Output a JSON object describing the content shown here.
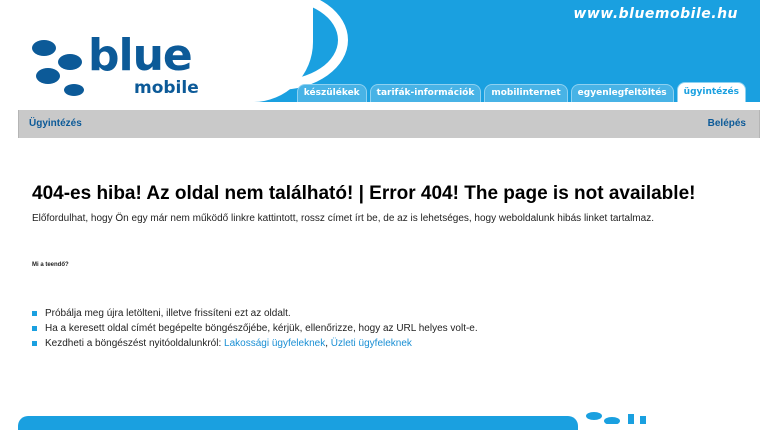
{
  "header": {
    "site_url": "www.bluemobile.hu",
    "logo_word": "blue",
    "logo_sub": "mobile"
  },
  "nav": {
    "tabs": [
      {
        "label": "készülékek",
        "active": false
      },
      {
        "label": "tarifák-információk",
        "active": false
      },
      {
        "label": "mobilinternet",
        "active": false
      },
      {
        "label": "egyenlegfeltöltés",
        "active": false
      },
      {
        "label": "ügyintézés",
        "active": true
      }
    ]
  },
  "subbar": {
    "breadcrumb": "Ügyintézés",
    "login": "Belépés"
  },
  "main": {
    "title": "404-es hiba! Az oldal nem található! | Error 404! The page is not available!",
    "description": "Előfordulhat, hogy Ön egy már nem működő linkre kattintott, rossz címet írt be, de az is lehetséges, hogy weboldalunk hibás linket tartalmaz.",
    "what_happened": "Mi a teendő?",
    "tips": {
      "reload": "Próbálja meg újra letölteni, illetve frissíteni ezt az oldalt.",
      "check_url": "Ha a keresett oldal címét begépelte böngészőjébe, kérjük, ellenőrizze, hogy az URL helyes volt-e.",
      "start_prefix": "Kezdheti a böngészést nyitóoldalunkról: ",
      "residential_link": "Lakossági ügyfeleknek",
      "separator": ", ",
      "business_link": "Üzleti ügyfeleknek"
    }
  },
  "colors": {
    "brand_blue": "#1aa0e0",
    "logo_navy": "#0c5a98",
    "subbar_gray": "#c9c9c9"
  }
}
